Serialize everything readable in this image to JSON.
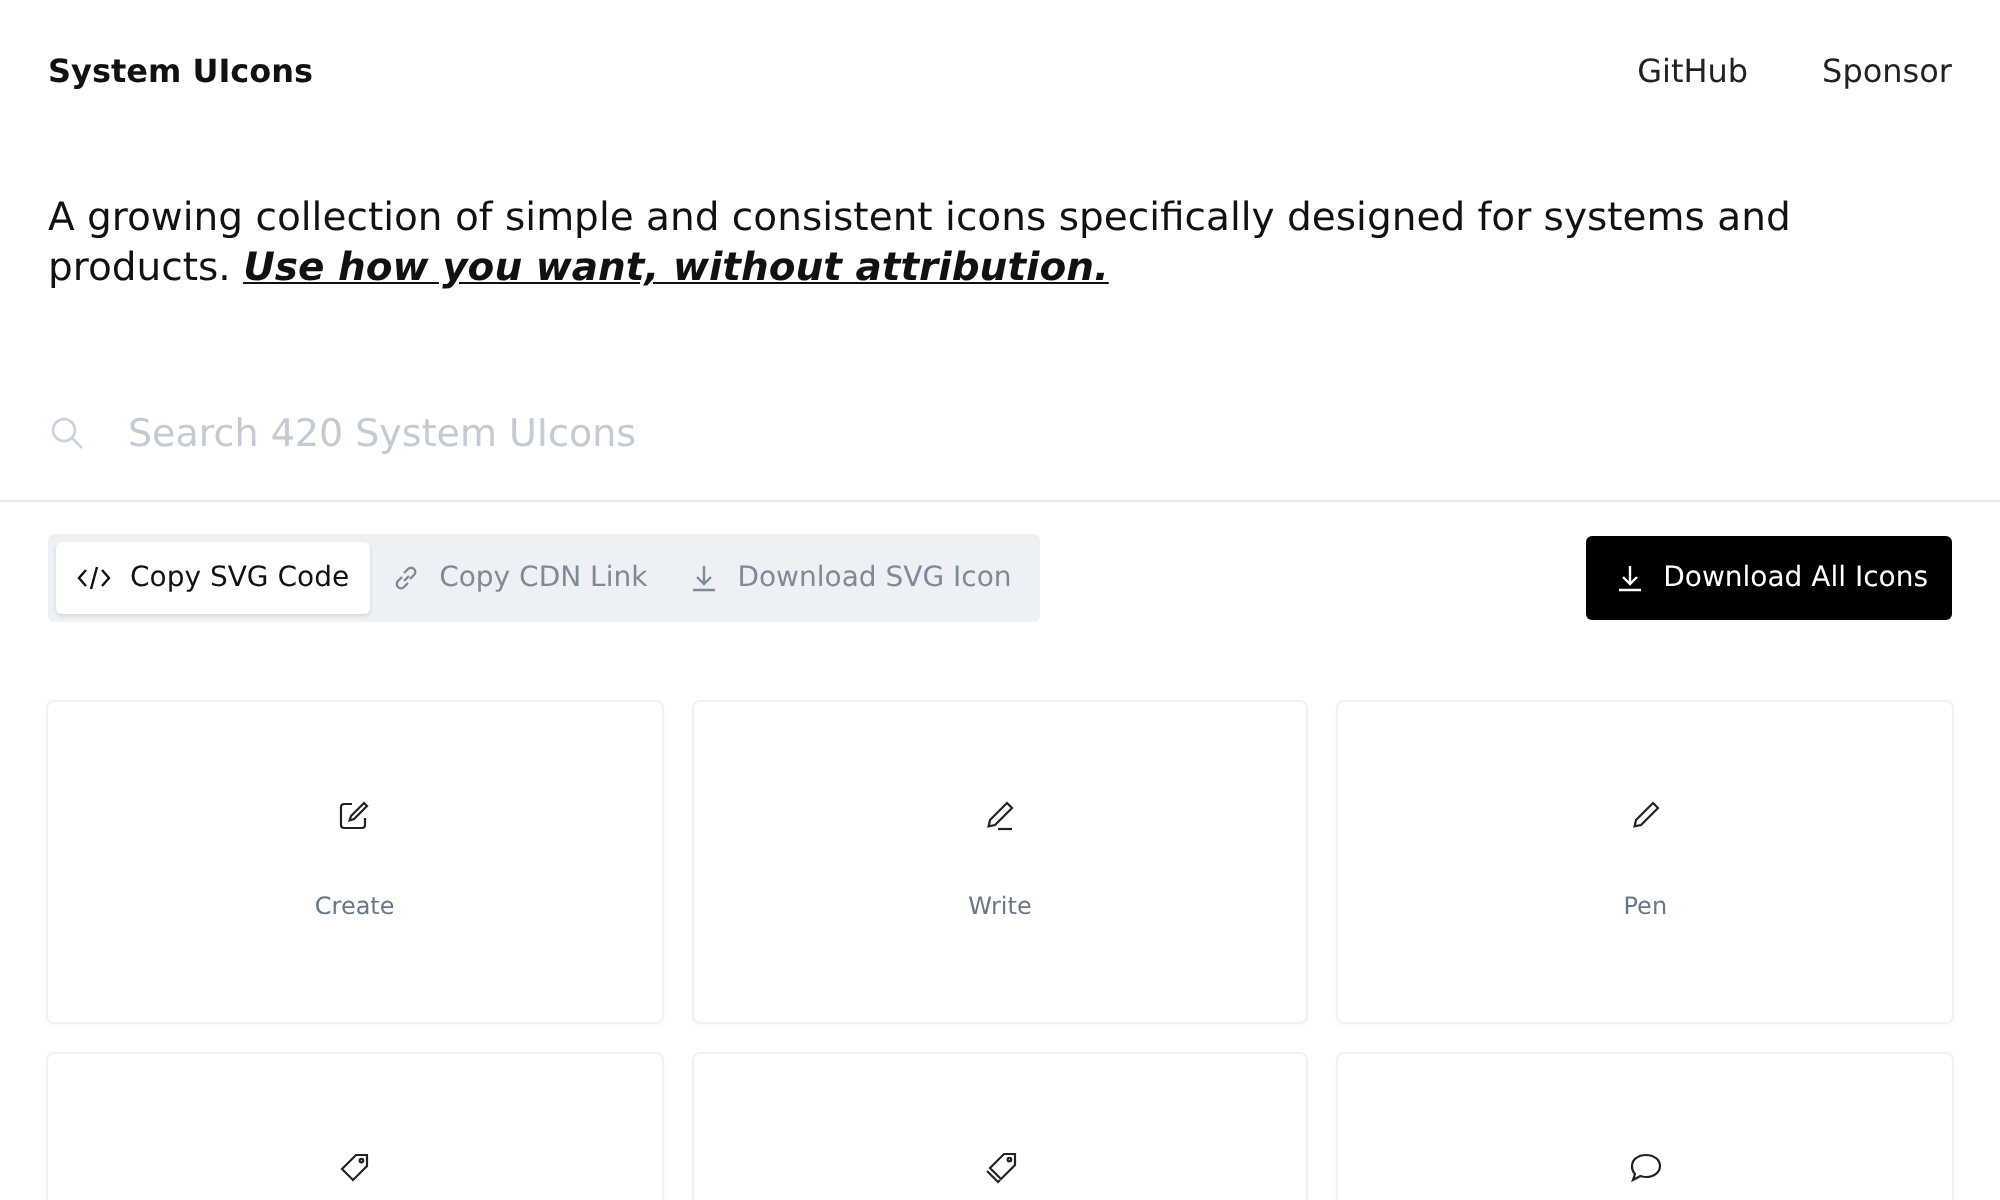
{
  "header": {
    "logo": "System UIcons",
    "links": [
      "GitHub",
      "Sponsor"
    ]
  },
  "intro": {
    "text": "A growing collection of simple and consistent icons specifically designed for systems and products. ",
    "link": "Use how you want, without attribution."
  },
  "search": {
    "placeholder": "Search 420 System UIcons"
  },
  "modes": [
    {
      "label": "Copy SVG Code",
      "kind": "code",
      "selected": true
    },
    {
      "label": "Copy CDN Link",
      "kind": "link",
      "selected": false
    },
    {
      "label": "Download SVG Icon",
      "kind": "download",
      "selected": false
    }
  ],
  "download_all": {
    "label": "Download All Icons"
  },
  "icons": [
    {
      "kind": "create",
      "label": "Create"
    },
    {
      "kind": "write",
      "label": "Write"
    },
    {
      "kind": "pen",
      "label": "Pen"
    },
    {
      "kind": "tag"
    },
    {
      "kind": "tags"
    },
    {
      "kind": "chat"
    }
  ]
}
